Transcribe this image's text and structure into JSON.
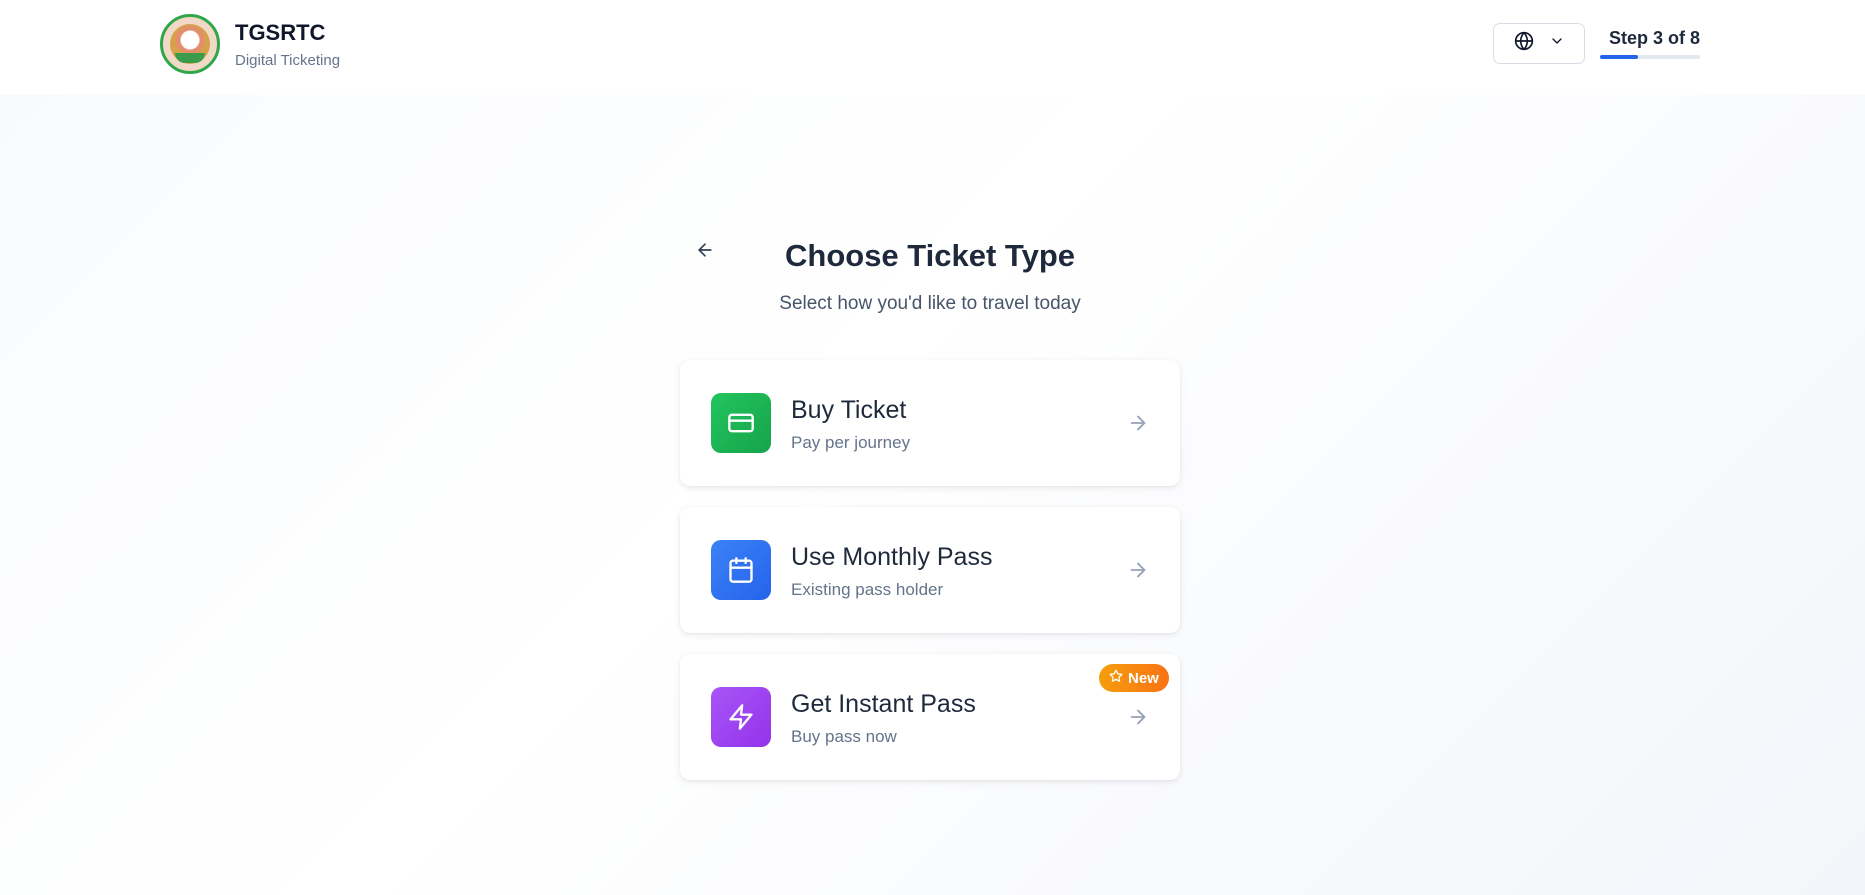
{
  "header": {
    "brand_title": "TGSRTC",
    "brand_subtitle": "Digital Ticketing",
    "language_icon": "globe-icon",
    "step_label": "Step 3 of 8",
    "step_progress": 0.375
  },
  "page": {
    "title": "Choose Ticket Type",
    "subtitle": "Select how you'd like to travel today"
  },
  "options": [
    {
      "title": "Buy Ticket",
      "subtitle": "Pay per journey",
      "icon": "credit-card-icon",
      "color": "#22c55e"
    },
    {
      "title": "Use Monthly Pass",
      "subtitle": "Existing pass holder",
      "icon": "calendar-icon",
      "color": "#3b82f6"
    },
    {
      "title": "Get Instant Pass",
      "subtitle": "Buy pass now",
      "icon": "lightning-icon",
      "color": "#a855f7",
      "badge": "New"
    }
  ],
  "colors": {
    "accent": "#2563eb",
    "badge_gradient_start": "#f59e0b",
    "badge_gradient_end": "#f97316"
  }
}
